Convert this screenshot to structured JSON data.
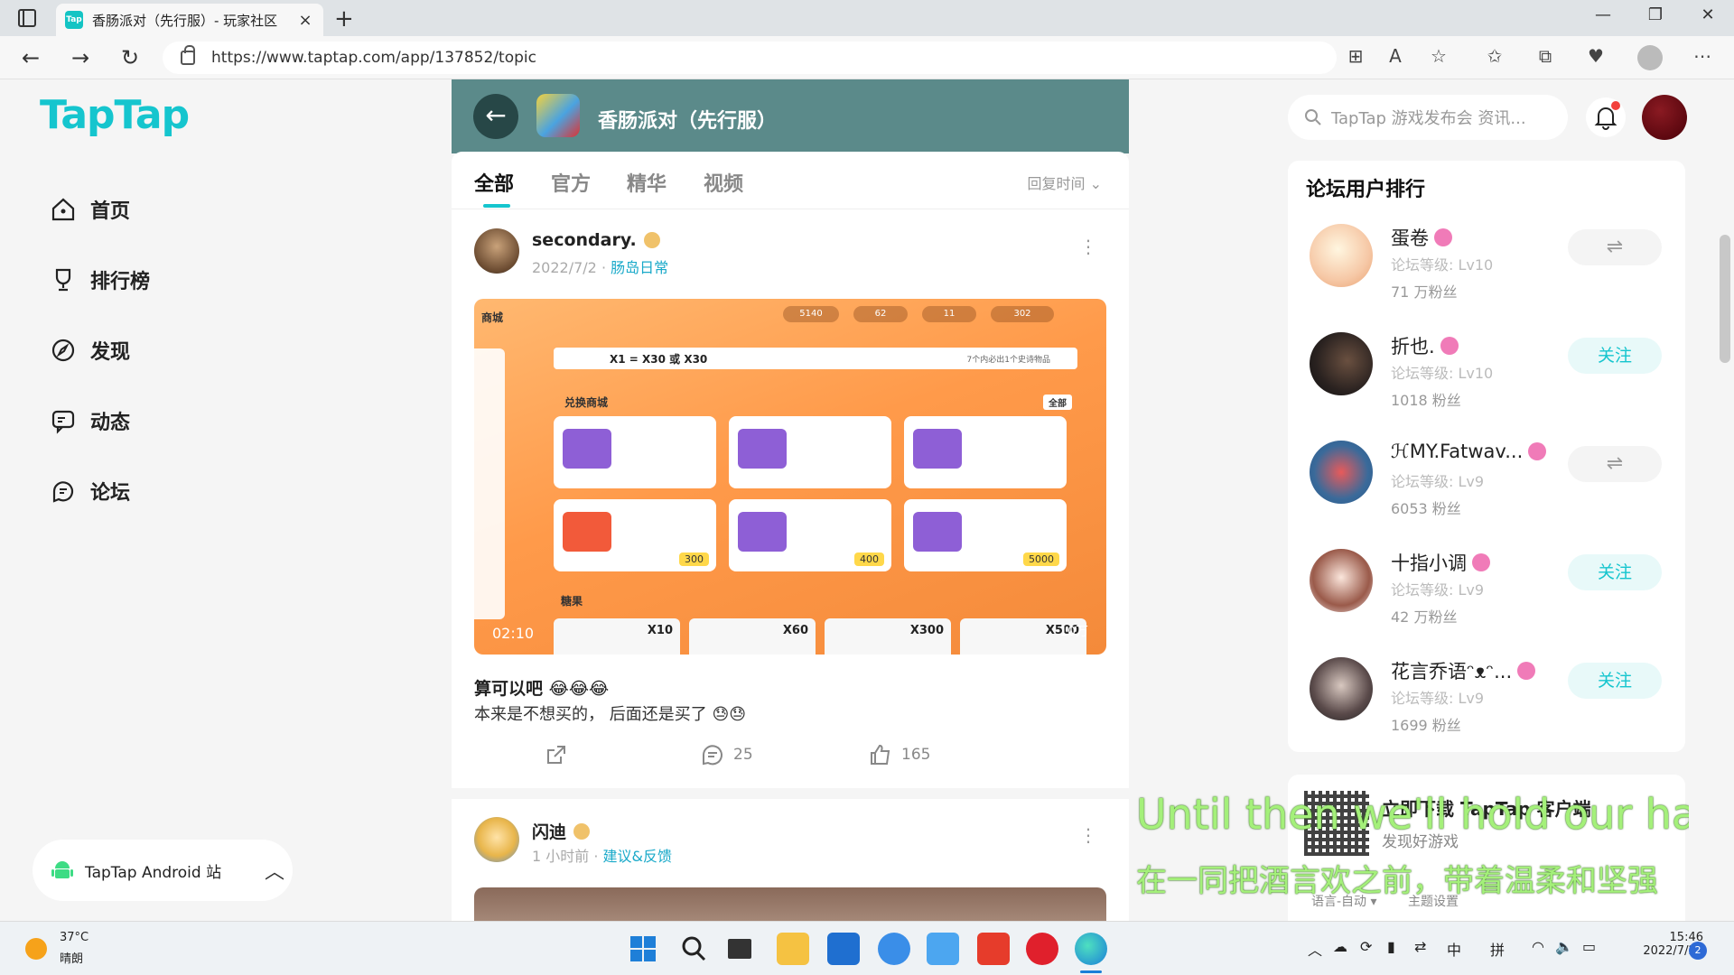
{
  "browser": {
    "tab_title": "香肠派对（先行服）- 玩家社区",
    "tab_favicon": "Tap",
    "url": "https://www.taptap.com/app/137852/topic"
  },
  "sidebar": {
    "logo": "TapTap",
    "items": [
      {
        "label": "首页",
        "icon": "home-icon"
      },
      {
        "label": "排行榜",
        "icon": "trophy-icon"
      },
      {
        "label": "发现",
        "icon": "compass-icon"
      },
      {
        "label": "动态",
        "icon": "chat-icon"
      },
      {
        "label": "论坛",
        "icon": "forum-icon"
      }
    ],
    "android_site": "TapTap Android 站"
  },
  "feed": {
    "game_title": "香肠派对（先行服）",
    "tabs": [
      "全部",
      "官方",
      "精华",
      "视频"
    ],
    "active_tab": "全部",
    "sort_label": "回复时间",
    "posts": [
      {
        "author": "secondary.",
        "date": "2022/7/2",
        "topic": "肠岛日常",
        "video_time": "02:10",
        "title": "算可以吧 😂😂😂",
        "body": "本来是不想买的， 后面还是买了 😓😓",
        "comments": "25",
        "likes": "165",
        "image": {
          "shop_label": "商城",
          "exchange_label": "兑换商城",
          "all_label": "全部",
          "candy_label": "糖果",
          "top_pills": [
            "5140",
            "62",
            "11",
            "302"
          ],
          "banner": "X1 = X30 或 X30",
          "banner_right": "7个内必出1个史诗物品",
          "prices": [
            "300",
            "400",
            "5000"
          ],
          "candy_counts": [
            "X10",
            "X60",
            "X300",
            "X500"
          ],
          "watermark": "10万"
        }
      },
      {
        "author": "闪迪",
        "date": "1 小时前",
        "topic": "建议&反馈"
      }
    ]
  },
  "right": {
    "search_placeholder": "TapTap 游戏发布会 资讯...",
    "rank_title": "论坛用户排行",
    "users": [
      {
        "name": "蛋卷",
        "level": "论坛等级: Lv10",
        "fans": "71 万粉丝",
        "button": "⇌",
        "followed": true
      },
      {
        "name": "折也.",
        "level": "论坛等级: Lv10",
        "fans": "1018 粉丝",
        "button": "关注",
        "followed": false
      },
      {
        "name": "ℋMY.Fatwav...",
        "level": "论坛等级: Lv9",
        "fans": "6053 粉丝",
        "button": "⇌",
        "followed": true
      },
      {
        "name": "十指小调",
        "level": "论坛等级: Lv9",
        "fans": "42 万粉丝",
        "button": "关注",
        "followed": false
      },
      {
        "name": "花言乔语ᵔᴥᵔ...",
        "level": "论坛等级: Lv9",
        "fans": "1699 粉丝",
        "button": "关注",
        "followed": false
      }
    ],
    "download_title": "立即下载 TapTap 客户端",
    "download_sub": "发现好游戏",
    "lang_link": "语言-自动 ▾",
    "theme_link": "主题设置"
  },
  "lyrics": {
    "en": "Until then we'll hold our hand",
    "zh": "在一同把酒言欢之前，带着温柔和坚强"
  },
  "taskbar": {
    "temp": "37°C",
    "weather": "晴朗",
    "ime1": "中",
    "ime2": "拼",
    "time": "15:46",
    "date": "2022/7/24",
    "notifications": "2"
  },
  "colors": {
    "brand": "#15c5ce",
    "header_bg": "#5b8a8a",
    "topic_link": "#19a9c9",
    "lyric": "#a4f07a"
  }
}
